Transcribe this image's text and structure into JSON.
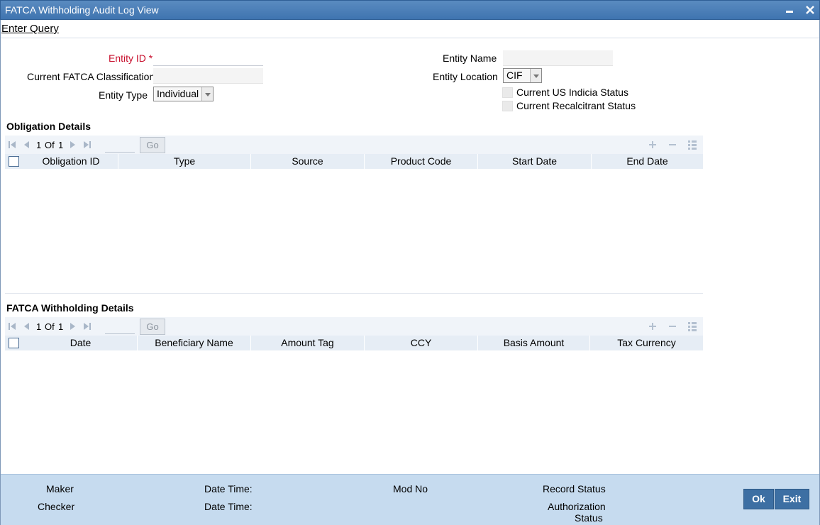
{
  "window": {
    "title": "FATCA Withholding Audit Log View"
  },
  "toolbar": {
    "enter_query": "Enter Query"
  },
  "form": {
    "entity_id_label": "Entity ID",
    "required_mark": "*",
    "entity_id_value": "",
    "current_classification_label": "Current FATCA Classification",
    "current_classification_value": "",
    "entity_type_label": "Entity Type",
    "entity_type_value": "Individual",
    "entity_name_label": "Entity Name",
    "entity_name_value": "",
    "entity_location_label": "Entity Location",
    "entity_location_value": "CIF",
    "us_indicia_label": "Current US Indicia Status",
    "us_indicia_checked": false,
    "recalcitrant_label": "Current Recalcitrant Status",
    "recalcitrant_checked": false
  },
  "obligation": {
    "title": "Obligation Details",
    "pager": {
      "current": "1",
      "of_label": "Of",
      "total": "1",
      "go_label": "Go"
    },
    "columns": [
      "Obligation ID",
      "Type",
      "Source",
      "Product Code",
      "Start Date",
      "End Date"
    ],
    "rows": []
  },
  "withholding": {
    "title": "FATCA Withholding Details",
    "pager": {
      "current": "1",
      "of_label": "Of",
      "total": "1",
      "go_label": "Go"
    },
    "columns": [
      "Date",
      "Beneficiary Name",
      "Amount Tag",
      "CCY",
      "Basis Amount",
      "Tax Currency"
    ],
    "rows": []
  },
  "footer": {
    "maker_label": "Maker",
    "checker_label": "Checker",
    "date_time_label": "Date Time:",
    "mod_no_label": "Mod No",
    "record_status_label": "Record Status",
    "authorization_label": "Authorization",
    "status_label": "Status",
    "ok_label": "Ok",
    "exit_label": "Exit"
  },
  "colors": {
    "titlebar": "#4a7fb8",
    "required_label": "#c8102e",
    "grid_header": "#e6edf5",
    "footer_bg": "#c6dbef",
    "button_bg": "#3d6fa3"
  }
}
